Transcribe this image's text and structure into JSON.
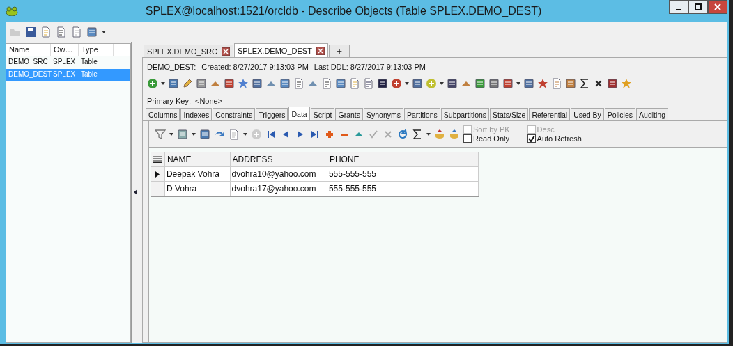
{
  "window": {
    "title": "SPLEX@localhost:1521/orcldb - Describe Objects (Table SPLEX.DEMO_DEST)"
  },
  "object_list": {
    "columns": [
      "Name",
      "Ow…",
      "Type"
    ],
    "rows": [
      {
        "cells": [
          "DEMO_SRC",
          "SPLEX",
          "Table"
        ],
        "selected": false
      },
      {
        "cells": [
          "DEMO_DEST",
          "SPLEX",
          "Table"
        ],
        "selected": true
      }
    ]
  },
  "doc_tabs": [
    {
      "label": "SPLEX.DEMO_SRC",
      "selected": false
    },
    {
      "label": "SPLEX.DEMO_DEST",
      "selected": true
    }
  ],
  "new_tab": "+",
  "info": {
    "object": "DEMO_DEST:",
    "created": "Created: 8/27/2017 9:13:03 PM",
    "last_ddl": "Last DDL: 8/27/2017 9:13:03 PM"
  },
  "primary_key": {
    "label": "Primary Key:",
    "value": "<None>"
  },
  "sub_tabs": [
    {
      "label": "Columns",
      "selected": false
    },
    {
      "label": "Indexes",
      "selected": false
    },
    {
      "label": "Constraints",
      "selected": false
    },
    {
      "label": "Triggers",
      "selected": false
    },
    {
      "label": "Data",
      "selected": true
    },
    {
      "label": "Script",
      "selected": false
    },
    {
      "label": "Grants",
      "selected": false
    },
    {
      "label": "Synonyms",
      "selected": false
    },
    {
      "label": "Partitions",
      "selected": false
    },
    {
      "label": "Subpartitions",
      "selected": false
    },
    {
      "label": "Stats/Size",
      "selected": false
    },
    {
      "label": "Referential",
      "selected": false
    },
    {
      "label": "Used By",
      "selected": false
    },
    {
      "label": "Policies",
      "selected": false
    },
    {
      "label": "Auditing",
      "selected": false
    }
  ],
  "options": [
    [
      {
        "label": "Sort by PK",
        "checked": false,
        "disabled": true
      },
      {
        "label": "Read Only",
        "checked": false,
        "disabled": false
      }
    ],
    [
      {
        "label": "Desc",
        "checked": false,
        "disabled": true
      },
      {
        "label": "Auto Refresh",
        "checked": true,
        "disabled": false
      }
    ]
  ],
  "grid": {
    "columns": [
      "NAME",
      "ADDRESS",
      "PHONE"
    ],
    "rows": [
      {
        "cells": [
          "Deepak Vohra",
          "dvohra10@yahoo.com",
          "555-555-555"
        ],
        "current": true
      },
      {
        "cells": [
          "D Vohra",
          "dvohra17@yahoo.com",
          "555-555-555"
        ],
        "current": false
      }
    ]
  }
}
